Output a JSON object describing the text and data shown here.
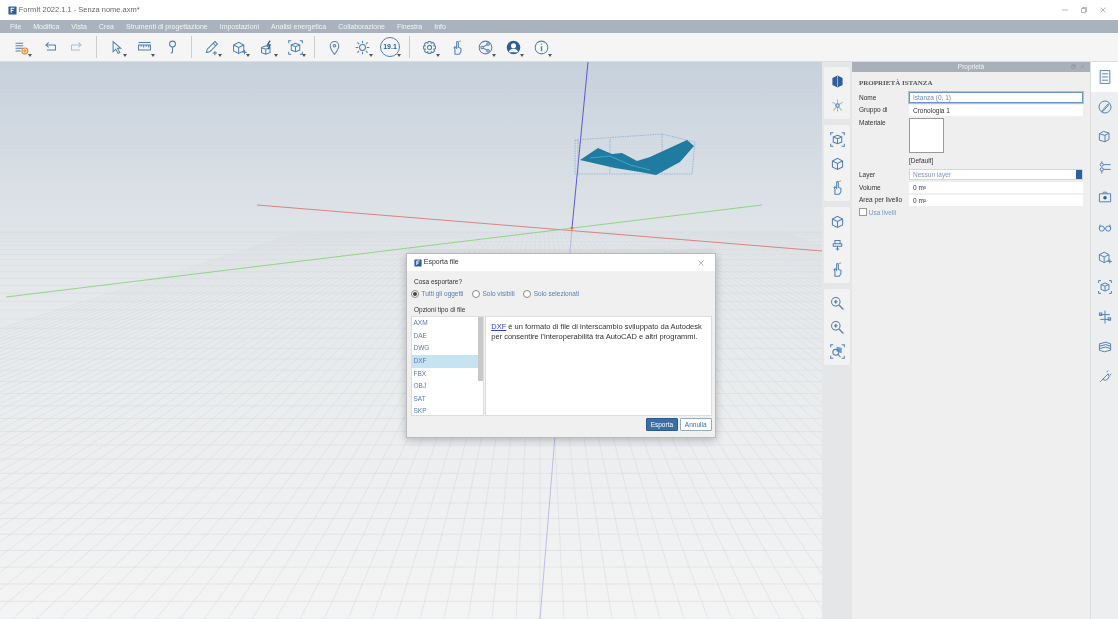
{
  "window": {
    "title": "FormIt 2022.1.1 - Senza nome.axm*"
  },
  "menu": [
    "File",
    "Modifica",
    "Vista",
    "Crea",
    "Strumenti di progettazione",
    "Impostazioni",
    "Analisi energetica",
    "Collaborazione",
    "Finestra",
    "Info"
  ],
  "toolbar": {
    "badge": "19.1"
  },
  "properties": {
    "title": "Proprietà",
    "heading": "PROPRIETÀ ISTANZA",
    "fields": [
      {
        "kind": "text",
        "label": "Nome",
        "value": "Istanza (0, 1)",
        "focused": true
      },
      {
        "kind": "text",
        "label": "Gruppo di",
        "value": "Cronologia 1",
        "focused": false
      },
      {
        "kind": "swatch",
        "label": "Materiale",
        "value": "[Default]",
        "focused": false
      },
      {
        "kind": "select",
        "label": "Layer",
        "value": "Nessun layer",
        "focused": false
      },
      {
        "kind": "text",
        "label": "Volume",
        "value": "0 m³",
        "focused": false
      },
      {
        "kind": "text",
        "label": "Area per livello",
        "value": "0 m²",
        "focused": false
      }
    ],
    "checkbox": {
      "label": "Usa livelli",
      "checked": false
    }
  },
  "side_tabs": [
    {
      "selected": true
    },
    {
      "selected": false
    },
    {
      "selected": false
    },
    {
      "selected": false
    },
    {
      "selected": false
    },
    {
      "selected": false
    },
    {
      "selected": false
    },
    {
      "selected": false
    },
    {
      "selected": false
    },
    {
      "selected": false
    },
    {
      "selected": false
    }
  ],
  "dialog": {
    "title": "Esporta file",
    "question": "Cosa esportare?",
    "options": [
      {
        "label": "Tutti gli oggetti",
        "selected": true
      },
      {
        "label": "Solo visibili",
        "selected": false
      },
      {
        "label": "Solo selezionati",
        "selected": false
      }
    ],
    "list_label": "Opzioni tipo di file",
    "file_types": [
      {
        "label": "AXM",
        "selected": false
      },
      {
        "label": "DAE",
        "selected": false
      },
      {
        "label": "DWG",
        "selected": false
      },
      {
        "label": "DXF",
        "selected": true
      },
      {
        "label": "FBX",
        "selected": false
      },
      {
        "label": "OBJ",
        "selected": false
      },
      {
        "label": "SAT",
        "selected": false
      },
      {
        "label": "SKP",
        "selected": false
      }
    ],
    "description": {
      "link": "DXF",
      "text": " è un formato di file di interscambio sviluppato da Autodesk per consentire l'interoperabilità tra AutoCAD e altri programmi."
    },
    "buttons": [
      {
        "label": "Esporta",
        "kind": "primary"
      },
      {
        "label": "Annulla",
        "kind": "secondary"
      }
    ]
  }
}
